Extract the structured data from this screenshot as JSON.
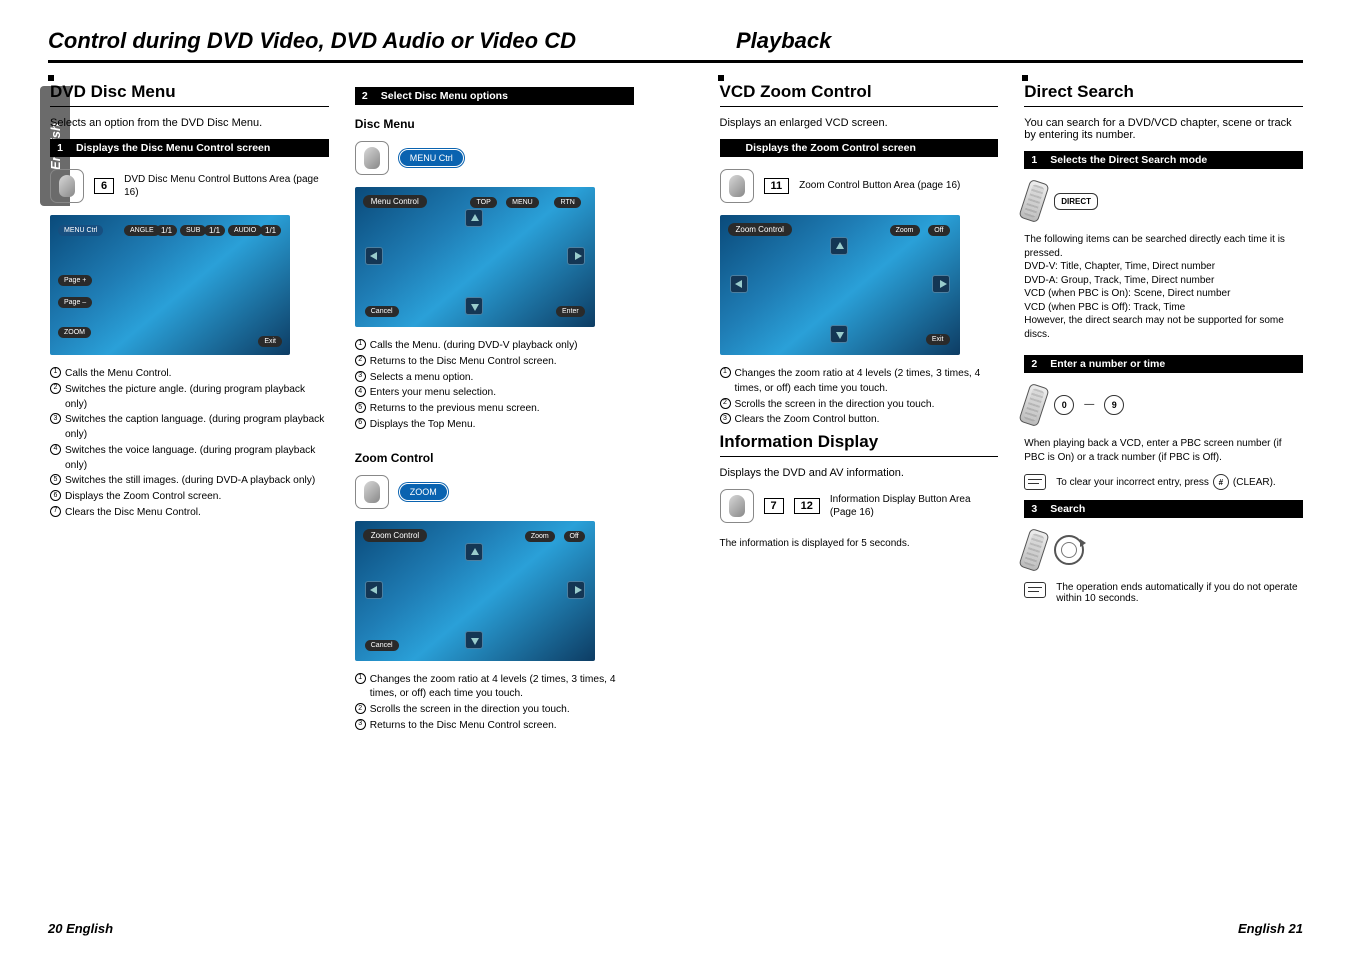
{
  "doc": {
    "title_left": "Control during DVD Video, DVD Audio or Video CD",
    "title_right": "Playback",
    "side_tab": "English",
    "footer_left": "20 English",
    "footer_right": "English 21"
  },
  "col1": {
    "heading": "DVD Disc Menu",
    "lead": "Selects an option from the DVD Disc Menu.",
    "step1_num": "1",
    "step1_text": "Displays the Disc Menu Control screen",
    "ref_num": "6",
    "ref_text": "DVD Disc Menu Control Buttons Area (page 16)",
    "ss_labels": {
      "menu_ctrl": "MENU Ctrl",
      "angle": "ANGLE",
      "v11a": "1/1",
      "sub": "SUB",
      "v11b": "1/1",
      "audio": "AUDIO",
      "v11c": "1/1",
      "pageup": "Page +",
      "pagedn": "Page –",
      "zoom": "ZOOM",
      "exit": "Exit"
    },
    "list": [
      "Calls the Menu Control.",
      "Switches the picture angle. (during program playback only)",
      "Switches the caption language. (during program playback only)",
      "Switches the voice language. (during program playback only)",
      "Switches the still images. (during DVD-A playback only)",
      "Displays the Zoom Control screen.",
      "Clears the Disc Menu Control."
    ]
  },
  "col2": {
    "step2_num": "2",
    "step2_text": "Select Disc Menu options",
    "sub_discmenu": "Disc Menu",
    "chip_menu": "MENU Ctrl",
    "ss1": {
      "title": "Menu Control",
      "top": "TOP",
      "menu": "MENU",
      "rtn": "RTN",
      "cancel": "Cancel",
      "enter": "Enter"
    },
    "list_discmenu": [
      "Calls the Menu. (during DVD-V playback only)",
      "Returns to the Disc Menu Control screen.",
      "Selects a menu option.",
      "Enters your menu selection.",
      "Returns to the previous menu screen.",
      "Displays the Top Menu."
    ],
    "sub_zoom": "Zoom Control",
    "chip_zoom": "ZOOM",
    "ss2": {
      "title": "Zoom Control",
      "zoom": "Zoom",
      "off": "Off",
      "cancel": "Cancel"
    },
    "list_zoom": [
      "Changes the zoom ratio at 4 levels (2 times, 3 times, 4 times, or off) each time you touch.",
      "Scrolls the screen in the direction you touch.",
      "Returns to the Disc Menu Control screen."
    ]
  },
  "col3": {
    "heading_vcd": "VCD Zoom Control",
    "lead_vcd": "Displays an enlarged VCD screen.",
    "step_blank_text": "Displays the Zoom Control screen",
    "ref_num": "11",
    "ref_text": "Zoom Control Button Area (page 16)",
    "ss": {
      "title": "Zoom Control",
      "zoom": "Zoom",
      "off": "Off",
      "exit": "Exit"
    },
    "list_vcd": [
      "Changes the zoom ratio at 4 levels (2 times, 3 times, 4 times, or off) each time you touch.",
      "Scrolls the screen in the direction you touch.",
      "Clears the Zoom Control button."
    ],
    "heading_info": "Information Display",
    "lead_info": "Displays the DVD and AV information.",
    "ref7": "7",
    "ref12": "12",
    "ref_info_text": "Information Display Button Area (Page 16)",
    "info_note": "The information is displayed for 5 seconds."
  },
  "col4": {
    "heading": "Direct Search",
    "lead": "You can search for a DVD/VCD chapter, scene or track by entering its number.",
    "step1_num": "1",
    "step1_text": "Selects the Direct Search mode",
    "direct_btn": "DIRECT",
    "para1": "The following items can be searched directly each time it is pressed.",
    "para2": "DVD-V: Title, Chapter, Time, Direct number",
    "para3": "DVD-A: Group, Track, Time, Direct number",
    "para4": "VCD (when PBC is On): Scene, Direct number",
    "para5": "VCD (when PBC is Off): Track, Time",
    "para6": "However, the direct search may not be supported for some discs.",
    "step2_num": "2",
    "step2_text": "Enter a number or time",
    "key0": "0",
    "dash": "—",
    "key9": "9",
    "para7": "When playing back a VCD, enter a PBC screen number (if PBC is On) or a track number (if PBC is Off).",
    "clear_note": "To clear your incorrect entry, press       (CLEAR).",
    "clear_key": "#",
    "step3_num": "3",
    "step3_text": "Search",
    "end_note": "The operation ends automatically if you do not operate within 10 seconds."
  }
}
